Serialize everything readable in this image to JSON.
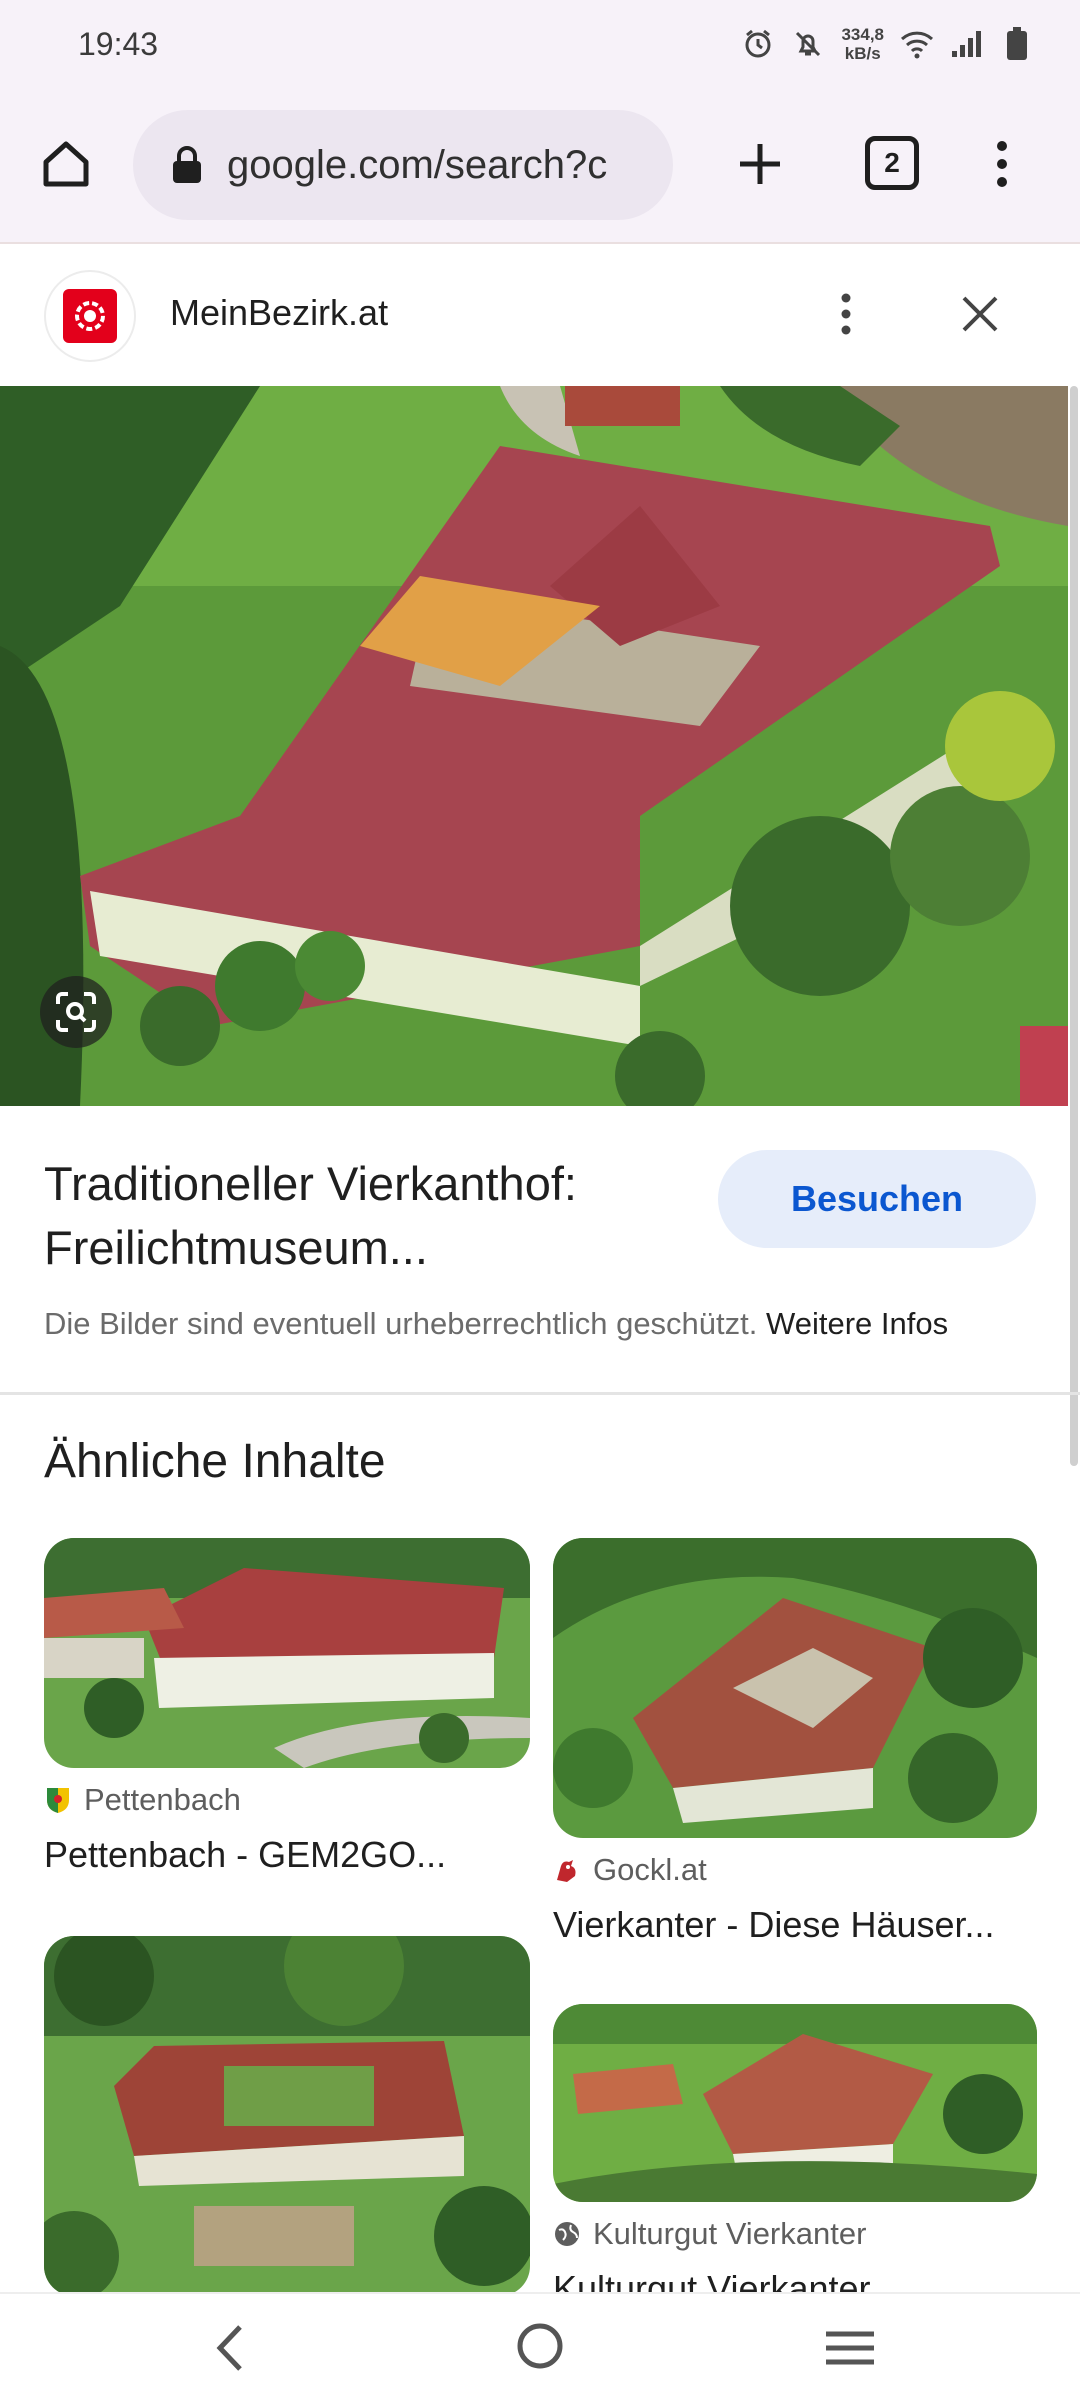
{
  "status_bar": {
    "time": "19:43",
    "net_speed_value": "334,8",
    "net_speed_unit": "kB/s",
    "icons": [
      "alarm-icon",
      "mute-icon",
      "wifi-icon",
      "signal-icon",
      "battery-icon"
    ]
  },
  "toolbar": {
    "url": "google.com/search?c",
    "tab_count": "2",
    "icons": [
      "home-icon",
      "lock-icon",
      "plus-icon",
      "menu-dots-icon"
    ]
  },
  "source": {
    "name": "MeinBezirk.at",
    "brand_color": "#e3001b"
  },
  "result": {
    "title_line1": "Traditioneller Vierkanthof:",
    "title_line2": "Freilichtmuseum...",
    "visit_label": "Besuchen",
    "copyright_text": "Die Bilder sind eventuell urheberrechtlich geschützt.",
    "more_info_label": "Weitere Infos"
  },
  "related": {
    "section_title": "Ähnliche Inhalte",
    "cards": [
      {
        "source": "Pettenbach",
        "title": "Pettenbach - GEM2GO..."
      },
      {
        "source": "Gockl.at",
        "title": "Vierkanter - Diese Häuser..."
      },
      {
        "source": "",
        "title": ""
      },
      {
        "source": "Kulturgut Vierkanter",
        "title": "Kulturgut Vierkanter"
      }
    ]
  },
  "colors": {
    "accent": "#0b57d0",
    "visit_button_bg": "#e6edfa",
    "chrome_bg": "#f7f2f9",
    "url_bar_bg": "#ece6f0"
  }
}
